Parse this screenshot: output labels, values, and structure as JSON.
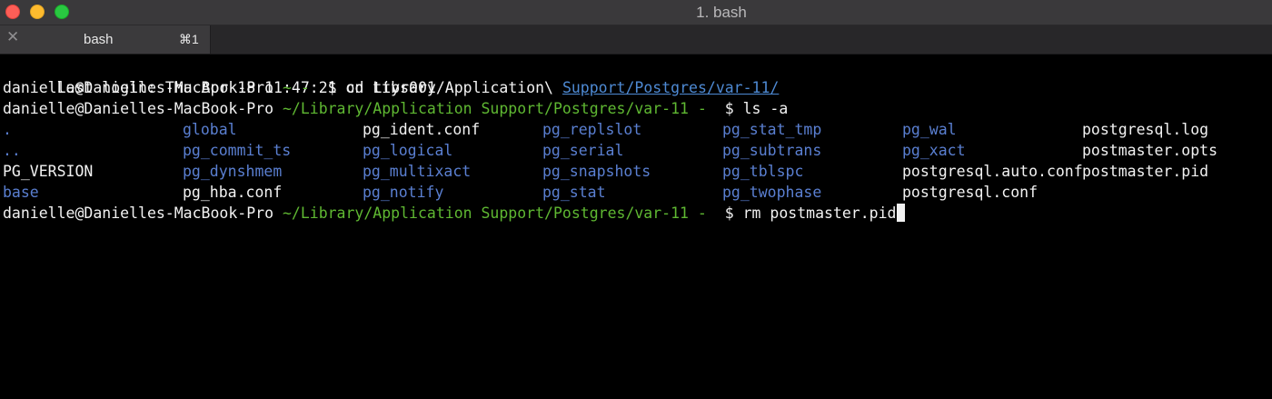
{
  "window": {
    "title": "1. bash"
  },
  "tab": {
    "close_glyph": "✕",
    "label": "bash",
    "shortcut": "⌘1"
  },
  "terminal": {
    "last_login": "Last login: Thu Apr 18 11:47:21 on ttys001",
    "prompt_user": "danielle@Danielles-MacBook-Pro",
    "cmd1": {
      "path": "~ -",
      "dollar": "  $ ",
      "command": "cd Library/Application\\ ",
      "link": "Support/Postgres/var-11/"
    },
    "cmd2": {
      "path": "~/Library/Application Support/Postgres/var-11 -",
      "dollar": "  $ ",
      "command": "ls -a"
    },
    "ls_rows": [
      [
        {
          "name": ".",
          "kind": "dir"
        },
        {
          "name": "global",
          "kind": "dir"
        },
        {
          "name": "pg_ident.conf",
          "kind": "file"
        },
        {
          "name": "pg_replslot",
          "kind": "dir"
        },
        {
          "name": "pg_stat_tmp",
          "kind": "dir"
        },
        {
          "name": "pg_wal",
          "kind": "dir"
        },
        {
          "name": "postgresql.log",
          "kind": "file"
        }
      ],
      [
        {
          "name": "..",
          "kind": "dir"
        },
        {
          "name": "pg_commit_ts",
          "kind": "dir"
        },
        {
          "name": "pg_logical",
          "kind": "dir"
        },
        {
          "name": "pg_serial",
          "kind": "dir"
        },
        {
          "name": "pg_subtrans",
          "kind": "dir"
        },
        {
          "name": "pg_xact",
          "kind": "dir"
        },
        {
          "name": "postmaster.opts",
          "kind": "file"
        }
      ],
      [
        {
          "name": "PG_VERSION",
          "kind": "file"
        },
        {
          "name": "pg_dynshmem",
          "kind": "dir"
        },
        {
          "name": "pg_multixact",
          "kind": "dir"
        },
        {
          "name": "pg_snapshots",
          "kind": "dir"
        },
        {
          "name": "pg_tblspc",
          "kind": "dir"
        },
        {
          "name": "postgresql.auto.conf",
          "kind": "file"
        },
        {
          "name": "postmaster.pid",
          "kind": "file"
        }
      ],
      [
        {
          "name": "base",
          "kind": "dir"
        },
        {
          "name": "pg_hba.conf",
          "kind": "file"
        },
        {
          "name": "pg_notify",
          "kind": "dir"
        },
        {
          "name": "pg_stat",
          "kind": "dir"
        },
        {
          "name": "pg_twophase",
          "kind": "dir"
        },
        {
          "name": "postgresql.conf",
          "kind": "file"
        }
      ]
    ],
    "cmd3": {
      "path": "~/Library/Application Support/Postgres/var-11 -",
      "dollar": "  $ ",
      "command": "rm postmaster.pid"
    }
  },
  "colors": {
    "background": "#000000",
    "text": "#f2f2f2",
    "prompt_path": "#5fb832",
    "directory": "#5a7fd1",
    "link": "#4e8ad4",
    "titlebar": "#3a393b",
    "tab_active": "#3b3a3c",
    "close_button": "#fd5e57",
    "minimize_button": "#febb2e",
    "maximize_button": "#29c841"
  }
}
